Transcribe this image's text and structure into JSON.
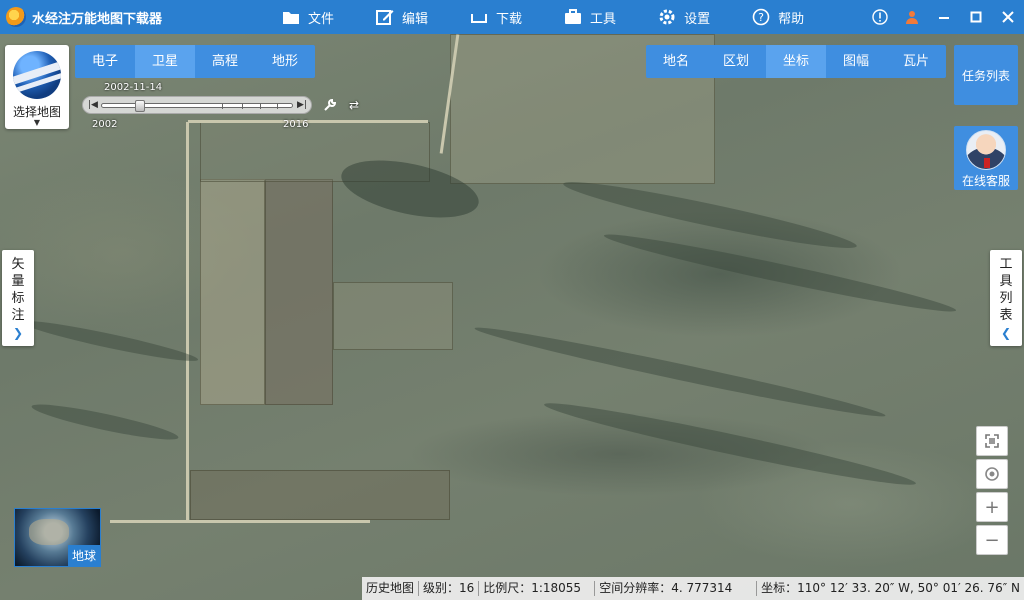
{
  "app": {
    "title": "水经注万能地图下载器"
  },
  "menu": [
    {
      "label": "文件",
      "icon": "folder-icon"
    },
    {
      "label": "编辑",
      "icon": "edit-icon"
    },
    {
      "label": "下载",
      "icon": "download-icon"
    },
    {
      "label": "工具",
      "icon": "toolbox-icon"
    },
    {
      "label": "设置",
      "icon": "gear-icon"
    },
    {
      "label": "帮助",
      "icon": "help-icon"
    }
  ],
  "map_types": [
    {
      "label": "电子",
      "active": false
    },
    {
      "label": "卫星",
      "active": true
    },
    {
      "label": "高程",
      "active": false
    },
    {
      "label": "地形",
      "active": false
    }
  ],
  "layers": [
    {
      "label": "地名",
      "active": false
    },
    {
      "label": "区划",
      "active": false
    },
    {
      "label": "坐标",
      "active": true
    },
    {
      "label": "图幅",
      "active": false
    },
    {
      "label": "瓦片",
      "active": false
    }
  ],
  "task_list": {
    "label": "任务列表"
  },
  "service": {
    "label": "在线客服"
  },
  "map_selector": {
    "label": "选择地图"
  },
  "timeline": {
    "current_date": "2002-11-14",
    "start_year": "2002",
    "end_year": "2016",
    "position": 0.17
  },
  "left_panel": {
    "label": "矢量标注"
  },
  "right_panel": {
    "label": "工具列表"
  },
  "earth": {
    "label": "地球"
  },
  "status": {
    "map_kind": "历史地图",
    "level": "级别：16",
    "scale": "比例尺：1:18055",
    "resolution": "空间分辨率：4. 777314",
    "coords": "坐标：110° 12′ 33. 20″ W, 50° 01′ 26. 76″ N"
  },
  "colors": {
    "accent": "#2a7fd0",
    "tab_active": "#5aa3ee",
    "tab_bg": "#3f8ee0"
  }
}
